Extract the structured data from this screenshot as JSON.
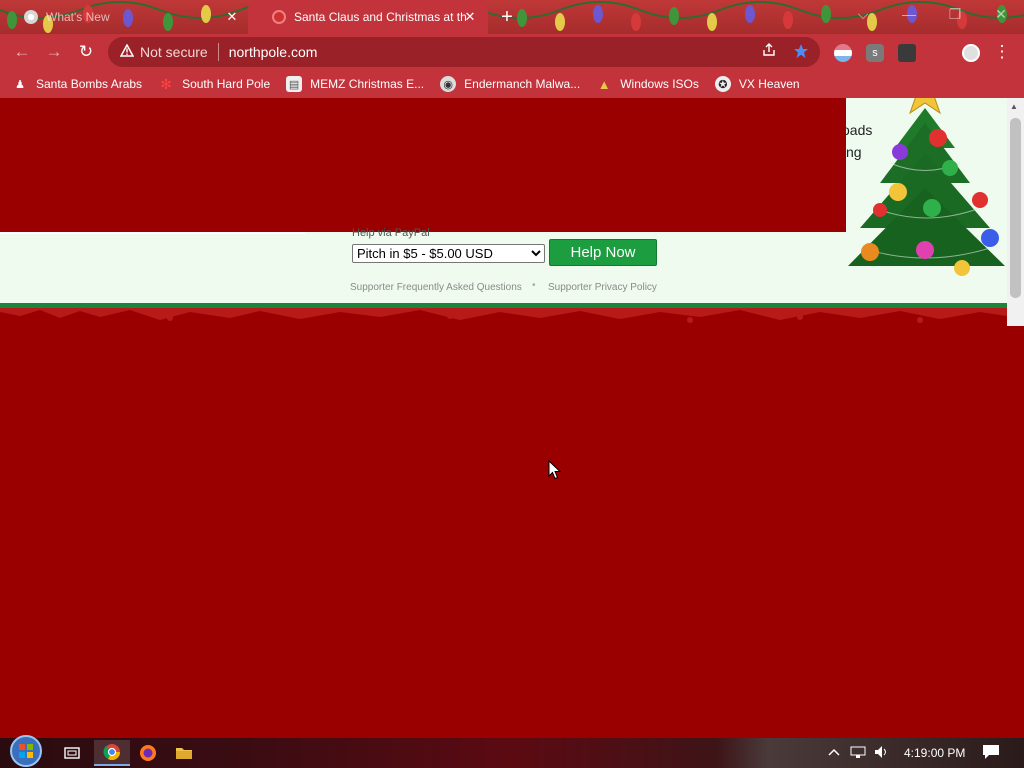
{
  "browser": {
    "tabs": [
      {
        "title": "What's New",
        "active": false
      },
      {
        "title": "Santa Claus and Christmas at the North Pole",
        "active": true
      }
    ],
    "new_tab_symbol": "+",
    "close_symbol": "✕",
    "window_controls": [
      "⌵",
      "—",
      "❐",
      "✕"
    ],
    "nav": {
      "back": "←",
      "forward": "→",
      "reload": "↻"
    },
    "address": {
      "security_icon": "warning-triangle-icon",
      "security_text": "Not secure",
      "url": "northpole.com"
    },
    "bookmarks": [
      {
        "label": "Santa Bombs Arabs",
        "icon": "santa-icon"
      },
      {
        "label": "South Hard Pole",
        "icon": "snowflake-icon"
      },
      {
        "label": "MEMZ Christmas E...",
        "icon": "page-icon"
      },
      {
        "label": "Endermanch Malwa...",
        "icon": "raccoon-icon"
      },
      {
        "label": "Windows ISOs",
        "icon": "tree-icon"
      },
      {
        "label": "VX Heaven",
        "icon": "vx-icon"
      }
    ]
  },
  "page": {
    "peek_text_1": "oads",
    "peek_text_2": "ng",
    "donation": {
      "paypal_label": "Help via PayPal",
      "selected_option": "Pitch in $5 - $5.00 USD",
      "button_label": "Help Now"
    },
    "links": {
      "faq": "Supporter Frequently Asked Questions",
      "separator": "•",
      "privacy": "Supporter Privacy Policy"
    }
  },
  "taskbar": {
    "apps": [
      "start-orb",
      "task-view",
      "chrome",
      "firefox",
      "file-explorer"
    ],
    "tray_caret": "^",
    "clock": "4:19:00 PM"
  },
  "colors": {
    "page_red": "#9b0000",
    "chrome_red": "#c2333c",
    "donation_band": "#eefbee",
    "help_button": "#1c9d3f"
  }
}
